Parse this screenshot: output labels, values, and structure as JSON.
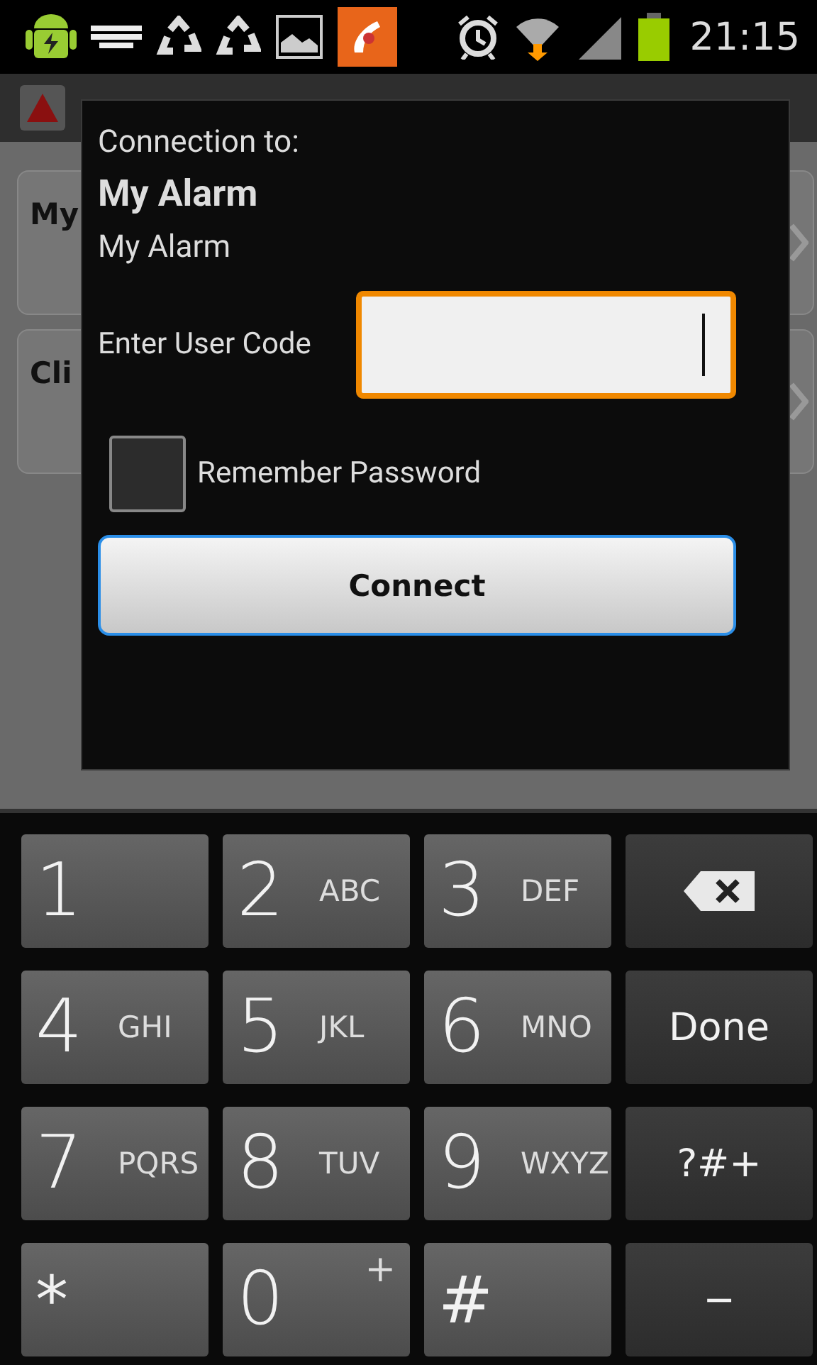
{
  "status_bar": {
    "time": "21:15"
  },
  "background": {
    "list_items": [
      {
        "title": "My"
      },
      {
        "title": "Cli"
      }
    ]
  },
  "dialog": {
    "heading": "Connection to:",
    "site_name": "My Alarm",
    "site_description": "My Alarm",
    "code_label": "Enter User Code",
    "code_field": {
      "focused": true
    },
    "remember": {
      "label": "Remember Password",
      "checked": false
    },
    "connect_button": "Connect"
  },
  "keyboard": {
    "keys": [
      {
        "kind": "digit",
        "label": "1"
      },
      {
        "kind": "digit",
        "label": "2",
        "letters": "ABC"
      },
      {
        "kind": "digit",
        "label": "3",
        "letters": "DEF"
      },
      {
        "kind": "backspace"
      },
      {
        "kind": "digit",
        "label": "4",
        "letters": "GHI"
      },
      {
        "kind": "digit",
        "label": "5",
        "letters": "JKL"
      },
      {
        "kind": "digit",
        "label": "6",
        "letters": "MNO"
      },
      {
        "kind": "action",
        "label": "Done"
      },
      {
        "kind": "digit",
        "label": "7",
        "letters": "PQRS"
      },
      {
        "kind": "digit",
        "label": "8",
        "letters": "TUV"
      },
      {
        "kind": "digit",
        "label": "9",
        "letters": "WXYZ"
      },
      {
        "kind": "action",
        "label": "?#+"
      },
      {
        "kind": "symbol",
        "label": "*"
      },
      {
        "kind": "digit",
        "label": "0",
        "letters": "+",
        "raised": true
      },
      {
        "kind": "symbol",
        "label": "#"
      },
      {
        "kind": "action",
        "label": "−"
      }
    ]
  }
}
